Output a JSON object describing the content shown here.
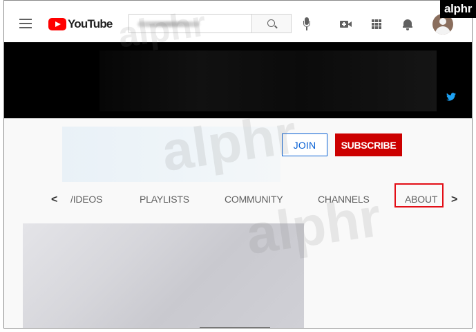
{
  "header": {
    "logo_text": "YouTube",
    "search_placeholder": "",
    "icons": [
      "menu-icon",
      "youtube-logo-icon",
      "search-icon",
      "mic-icon",
      "video-camera-icon",
      "apps-grid-icon",
      "bell-icon",
      "avatar"
    ]
  },
  "banner": {
    "social_icon": "twitter-icon",
    "twitter_color": "#1da1f2"
  },
  "channel": {
    "join_label": "JOIN",
    "subscribe_label": "SUBSCRIBE",
    "subscribe_color": "#cc0000",
    "join_color": "#065fd4"
  },
  "tabs": {
    "prev_arrow": "<",
    "next_arrow": ">",
    "items": [
      {
        "label": "VIDEOS",
        "visible_text": "/IDEOS"
      },
      {
        "label": "PLAYLISTS"
      },
      {
        "label": "COMMUNITY"
      },
      {
        "label": "CHANNELS"
      },
      {
        "label": "ABOUT",
        "highlighted": true
      }
    ],
    "highlight_color": "#e30e16"
  },
  "watermark": {
    "text": "alphr",
    "badge_text": "alphr"
  }
}
